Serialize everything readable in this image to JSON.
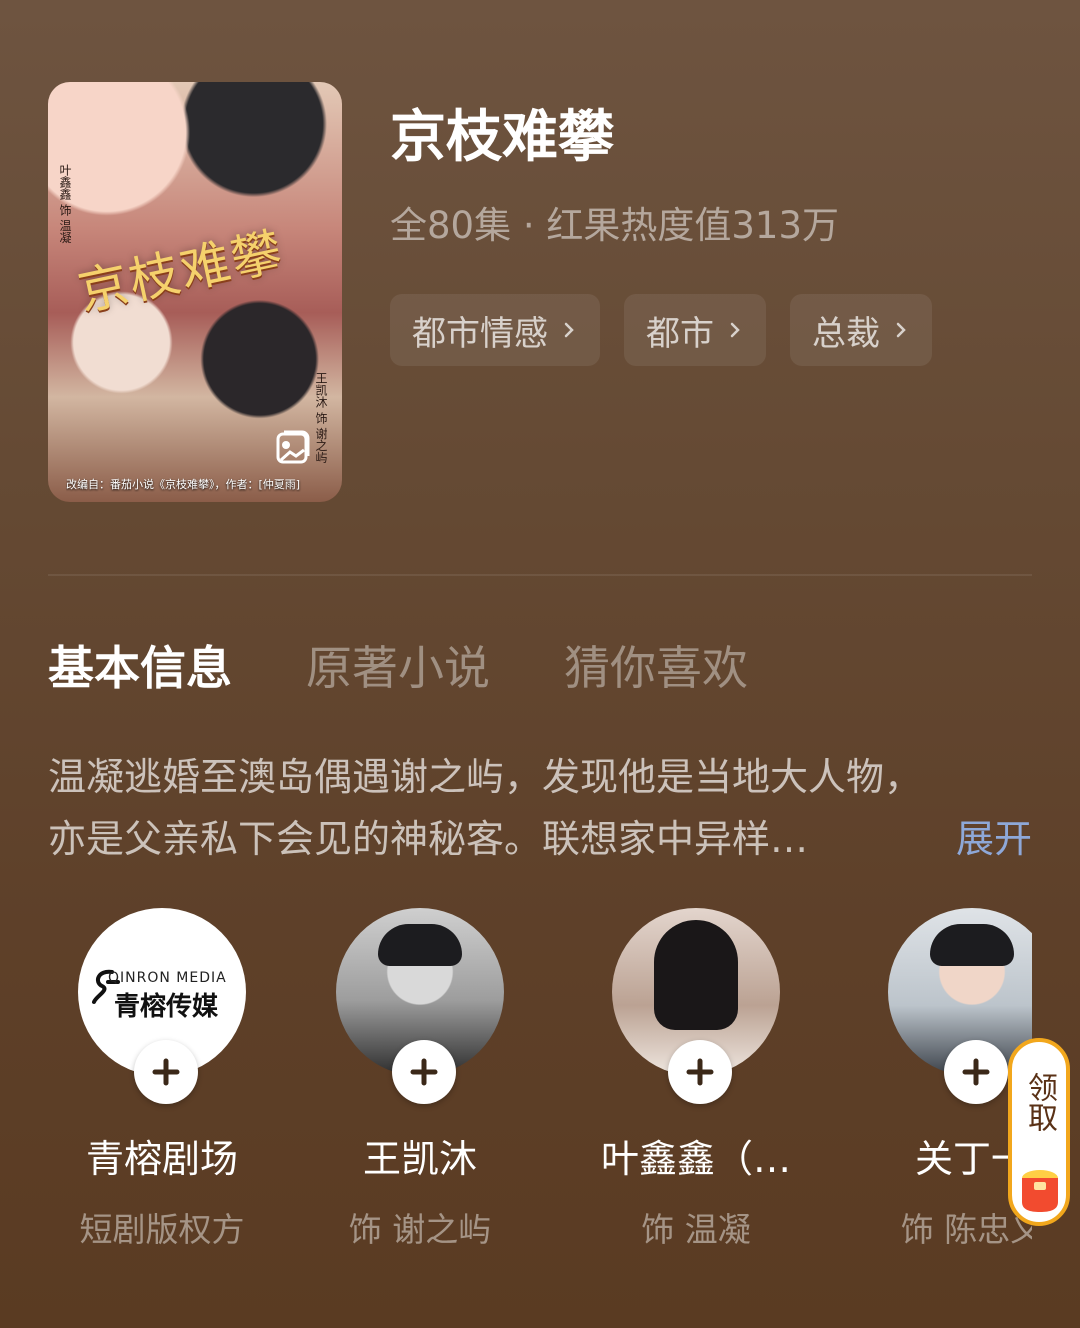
{
  "drama": {
    "title": "京枝难攀",
    "meta": "全80集 · 红果热度值313万",
    "tags": [
      "都市情感",
      "都市",
      "总裁"
    ]
  },
  "poster": {
    "title_art": "京枝难攀",
    "credit": "改编自：番茄小说《京枝难攀》，作者：[仲夏雨]",
    "side_left": "叶鑫鑫 饰 温凝",
    "side_right": "王凯沐 饰 谢之屿",
    "image_icon_name": "gallery-icon"
  },
  "tabs": [
    "基本信息",
    "原著小说",
    "猜你喜欢"
  ],
  "description": {
    "line1": "温凝逃婚至澳岛偶遇谢之屿，发现他是当地大人物，",
    "line2": "亦是父亲私下会见的神秘客。联想家中异样…",
    "expand": "展开"
  },
  "cast": [
    {
      "name": "青榕剧场",
      "role": "短剧版权方",
      "logo_top": "QINRON MEDIA",
      "logo_main": "青榕传媒"
    },
    {
      "name": "王凯沐",
      "role": "饰 谢之屿"
    },
    {
      "name": "叶鑫鑫（…",
      "role": "饰 温凝"
    },
    {
      "name": "关丁一",
      "role": "饰 陈忠义"
    }
  ],
  "bonus": {
    "label": "领取",
    "icon": "red-envelope-icon"
  }
}
